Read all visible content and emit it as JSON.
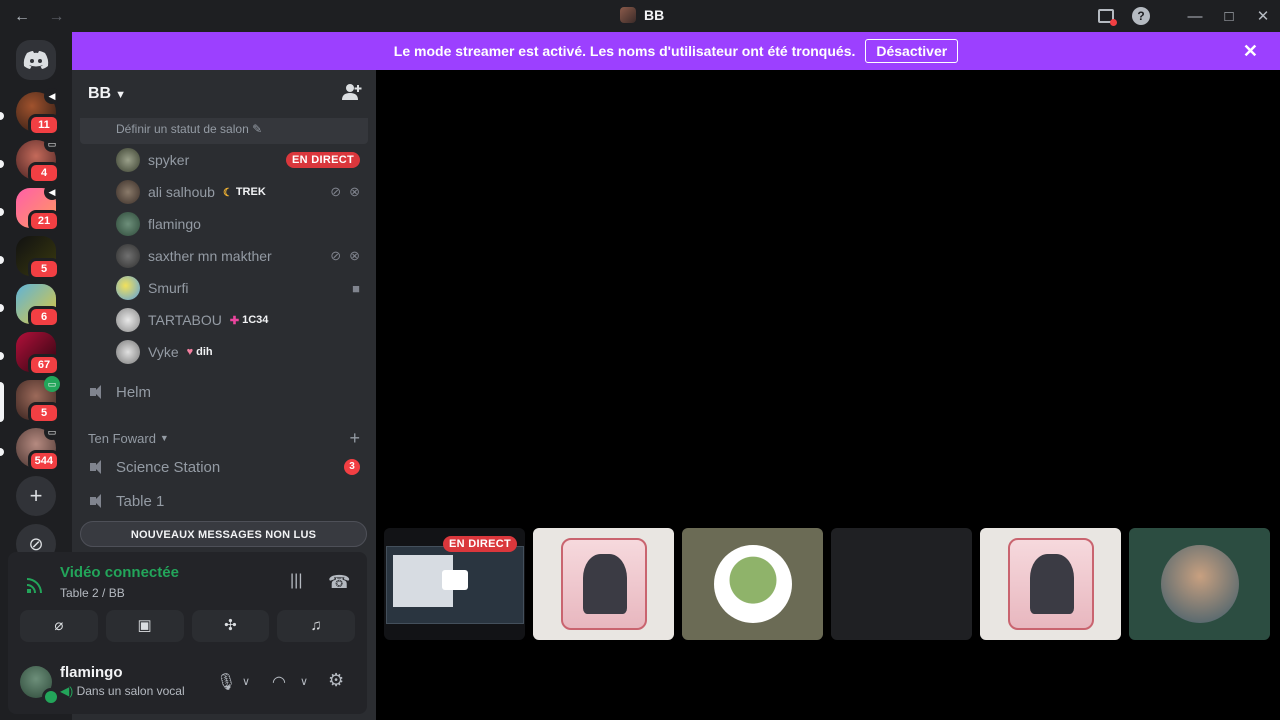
{
  "titlebar": {
    "title": "BB",
    "back_icon": "←",
    "forward_icon": "→",
    "help": "?",
    "minimize": "—",
    "maximize": "□",
    "close": "✕"
  },
  "banner": {
    "message": "Le mode streamer est activé. Les noms d'utilisateur ont été tronqués.",
    "button": "Désactiver",
    "close": "✕"
  },
  "servers": [
    {
      "badge": "11"
    },
    {
      "badge": "4"
    },
    {
      "badge": "21"
    },
    {
      "badge": "5"
    },
    {
      "badge": "6"
    },
    {
      "badge": "67"
    },
    {
      "badge": "5"
    },
    {
      "badge": "544"
    }
  ],
  "guild": {
    "name": "BB",
    "status_prompt": "Définir un statut de salon ✎"
  },
  "members": [
    {
      "name": "spyker",
      "badge": "EN DIRECT"
    },
    {
      "name": "ali salhoub",
      "tag": "TREK"
    },
    {
      "name": "flamingo"
    },
    {
      "name": "saxther mn makther"
    },
    {
      "name": "Smurfi"
    },
    {
      "name": "TARTABOU",
      "tag": "1C34"
    },
    {
      "name": "Vyke",
      "tag": "dih"
    }
  ],
  "channels": {
    "helm": "Helm",
    "category": "Ten Foward",
    "science": "Science Station",
    "science_count": "3",
    "table1": "Table 1"
  },
  "unread_bar": "NOUVEAUX MESSAGES NON LUS",
  "voice": {
    "title": "Vidéo connectée",
    "subtitle": "Table 2 / BB"
  },
  "user": {
    "name": "flamingo",
    "status": "Dans un salon vocal"
  },
  "stream": {
    "live_label": "EN DIRECT"
  },
  "colors": {
    "accent": "#9c40ff",
    "live": "#da373c",
    "online": "#23a55a",
    "badge": "#f23f43"
  }
}
